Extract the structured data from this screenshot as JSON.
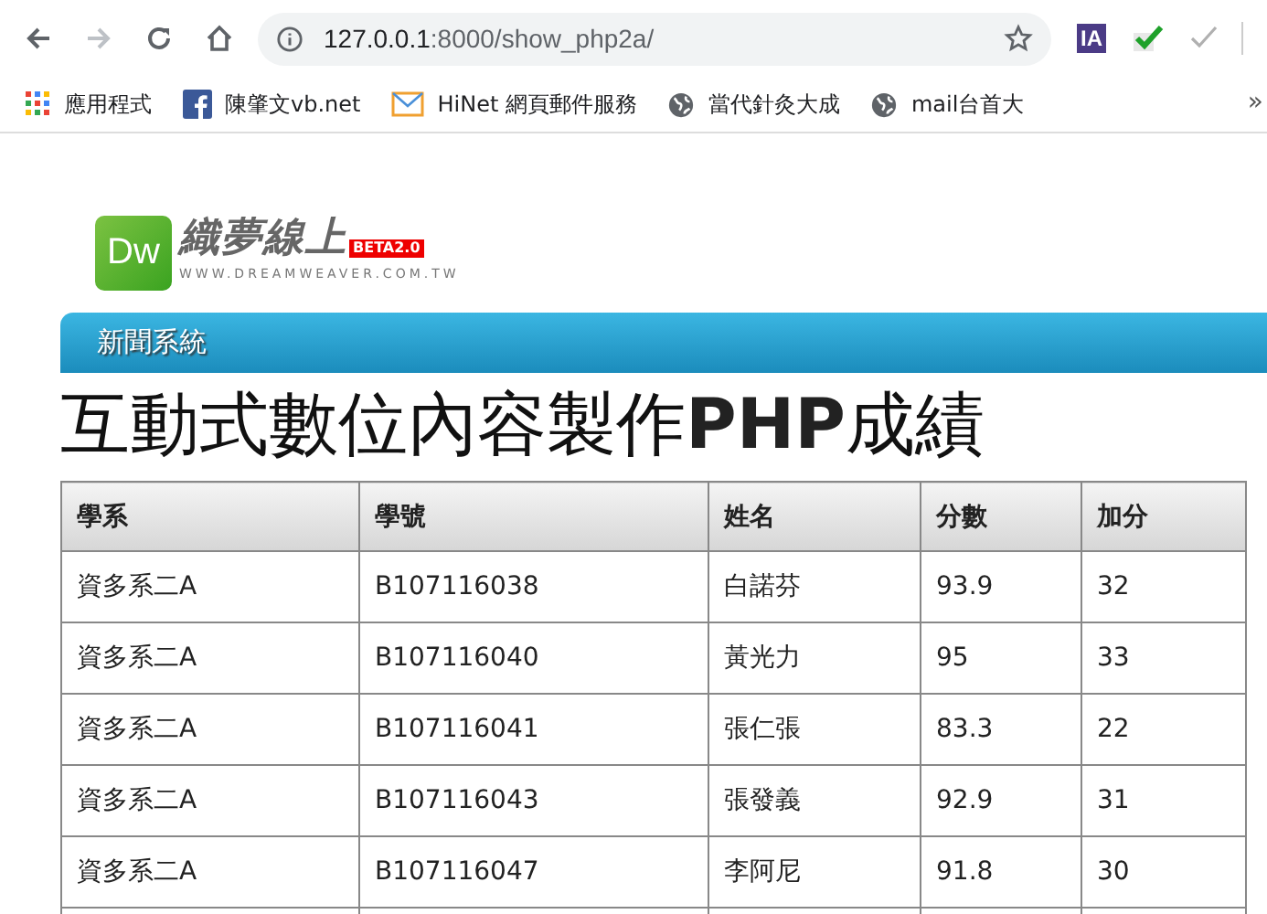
{
  "browser": {
    "back_enabled": true,
    "forward_enabled": false,
    "url_host": "127.0.0.1",
    "url_path": ":8000/show_php2a/",
    "extensions": [
      {
        "kind": "ia",
        "label": "IA"
      },
      {
        "kind": "check",
        "on": true
      },
      {
        "kind": "check",
        "on": false
      }
    ]
  },
  "bookmarks": [
    {
      "kind": "apps",
      "label": "應用程式"
    },
    {
      "kind": "facebook",
      "label": "陳肇文vb.net"
    },
    {
      "kind": "mail",
      "label": "HiNet 網頁郵件服務"
    },
    {
      "kind": "globe",
      "label": "當代針灸大成"
    },
    {
      "kind": "globe",
      "label": "mail台首大"
    }
  ],
  "bookmarks_more": "»",
  "logo": {
    "badge": "Dw",
    "title": "織夢線上",
    "beta": "BETA2.0",
    "domain": "WWW.DREAMWEAVER.COM.TW"
  },
  "nav": {
    "title": "新聞系統"
  },
  "heading": "互動式數位內容製作**PHP**成績",
  "table": {
    "columns": [
      "學系",
      "學號",
      "姓名",
      "分數",
      "加分"
    ],
    "rows": [
      [
        "資多系二A",
        "B107116038",
        "白諾芬",
        "93.9",
        "32"
      ],
      [
        "資多系二A",
        "B107116040",
        "黃光力",
        "95",
        "33"
      ],
      [
        "資多系二A",
        "B107116041",
        "張仁張",
        "83.3",
        "22"
      ],
      [
        "資多系二A",
        "B107116043",
        "張發義",
        "92.9",
        "31"
      ],
      [
        "資多系二A",
        "B107116047",
        "李阿尼",
        "91.8",
        "30"
      ]
    ]
  }
}
